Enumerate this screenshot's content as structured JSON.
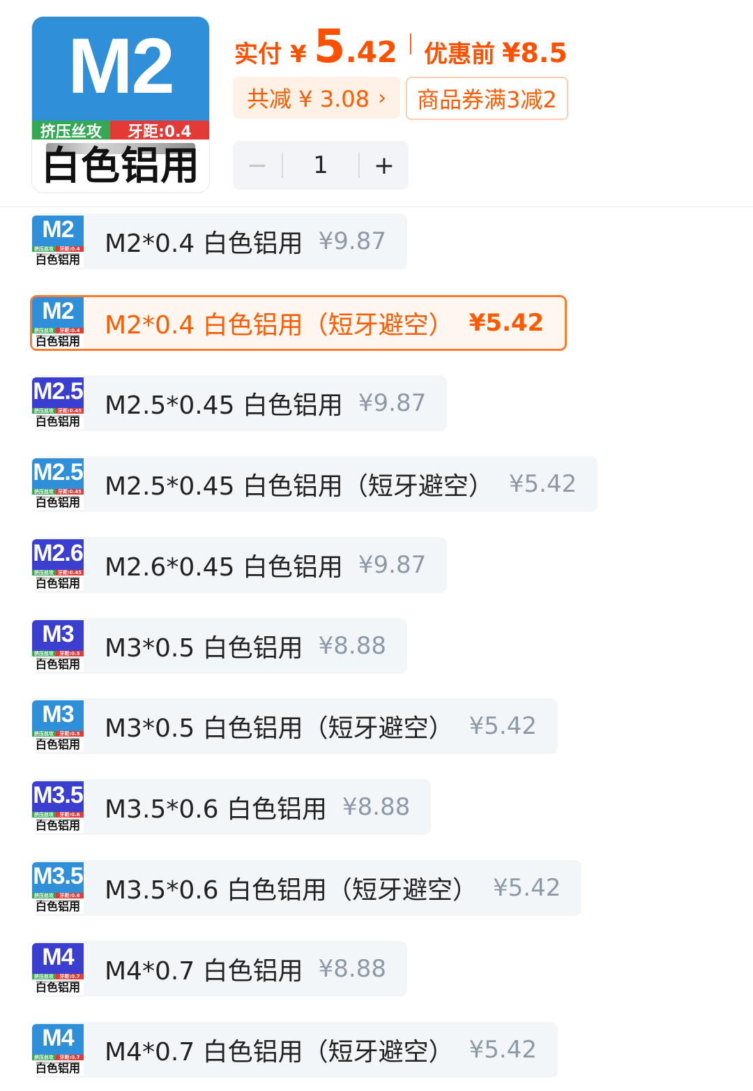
{
  "product": {
    "image": {
      "code": "M2",
      "band_left": "挤压丝攻",
      "band_right": "牙距:0.4",
      "label": "白色铝用"
    },
    "price_label": "实付",
    "currency": "¥",
    "price_int": "5",
    "price_dec": ".42",
    "orig_label": "优惠前",
    "orig_price": "¥8.5",
    "saved": "共减 ¥ 3.08",
    "saved_chevron": "›",
    "coupon": "商品券满3减2",
    "quantity": {
      "minus": "−",
      "value": "1",
      "plus": "+"
    }
  },
  "options": [
    {
      "code": "M2",
      "pitch": "牙距:0.4",
      "thumb_color": "blue",
      "name": "M2*0.4 白色铝用",
      "price": "¥9.87",
      "selected": false
    },
    {
      "code": "M2",
      "pitch": "牙距:0.4",
      "thumb_color": "blue",
      "name": "M2*0.4 白色铝用（短牙避空）",
      "price": "¥5.42",
      "selected": true
    },
    {
      "code": "M2.5",
      "pitch": "牙距:0.45",
      "thumb_color": "dark",
      "name": "M2.5*0.45 白色铝用",
      "price": "¥9.87",
      "selected": false
    },
    {
      "code": "M2.5",
      "pitch": "牙距:0.45",
      "thumb_color": "blue",
      "name": "M2.5*0.45 白色铝用（短牙避空）",
      "price": "¥5.42",
      "selected": false
    },
    {
      "code": "M2.6",
      "pitch": "牙距:0.45",
      "thumb_color": "dark",
      "name": "M2.6*0.45 白色铝用",
      "price": "¥9.87",
      "selected": false
    },
    {
      "code": "M3",
      "pitch": "牙距:0.5",
      "thumb_color": "dark",
      "name": "M3*0.5 白色铝用",
      "price": "¥8.88",
      "selected": false
    },
    {
      "code": "M3",
      "pitch": "牙距:0.5",
      "thumb_color": "blue",
      "name": "M3*0.5 白色铝用（短牙避空）",
      "price": "¥5.42",
      "selected": false
    },
    {
      "code": "M3.5",
      "pitch": "牙距:0.6",
      "thumb_color": "dark",
      "name": "M3.5*0.6 白色铝用",
      "price": "¥8.88",
      "selected": false
    },
    {
      "code": "M3.5",
      "pitch": "牙距:0.6",
      "thumb_color": "blue",
      "name": "M3.5*0.6 白色铝用（短牙避空）",
      "price": "¥5.42",
      "selected": false
    },
    {
      "code": "M4",
      "pitch": "牙距:0.7",
      "thumb_color": "dark",
      "name": "M4*0.7 白色铝用",
      "price": "¥8.88",
      "selected": false
    },
    {
      "code": "M4",
      "pitch": "牙距:0.7",
      "thumb_color": "blue",
      "name": "M4*0.7 白色铝用（短牙避空）",
      "price": "¥5.42",
      "selected": false
    }
  ],
  "thumb_band_left": "挤压丝攻",
  "thumb_label": "白色铝用",
  "colors": {
    "accent": "#ff5000",
    "thumb_blue": "#2f8fd8",
    "thumb_dark": "#3b3fcf",
    "chip_bg": "#f3f6f9"
  }
}
